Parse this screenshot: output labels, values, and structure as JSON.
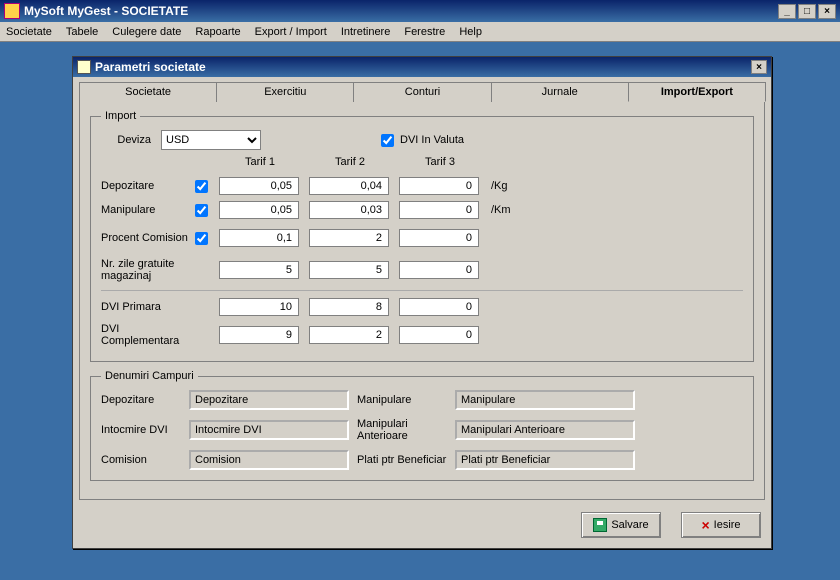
{
  "app": {
    "title": "MySoft MyGest  - SOCIETATE"
  },
  "menu": {
    "items": [
      "Societate",
      "Tabele",
      "Culegere date",
      "Rapoarte",
      "Export / Import",
      "Intretinere",
      "Ferestre",
      "Help"
    ]
  },
  "child": {
    "title": "Parametri societate"
  },
  "tabs": {
    "items": [
      "Societate",
      "Exercitiu",
      "Conturi",
      "Jurnale",
      "Import/Export"
    ],
    "active": 4
  },
  "import": {
    "legend": "Import",
    "deviza_label": "Deviza",
    "deviza_value": "USD",
    "dvi_in_valuta_label": "DVI In Valuta",
    "dvi_in_valuta_checked": true,
    "headers": {
      "t1": "Tarif 1",
      "t2": "Tarif 2",
      "t3": "Tarif 3"
    },
    "rows": {
      "depozitare": {
        "label": "Depozitare",
        "chk": true,
        "t1": "0,05",
        "t2": "0,04",
        "t3": "0",
        "unit": "/Kg"
      },
      "manipulare": {
        "label": "Manipulare",
        "chk": true,
        "t1": "0,05",
        "t2": "0,03",
        "t3": "0",
        "unit": "/Km"
      },
      "procent": {
        "label": "Procent Comision",
        "chk": true,
        "t1": "0,1",
        "t2": "2",
        "t3": "0",
        "unit": ""
      },
      "magazinaj": {
        "label": "Nr. zile gratuite magazinaj",
        "t1": "5",
        "t2": "5",
        "t3": "0",
        "unit": ""
      },
      "dvi_primara": {
        "label": "DVI Primara",
        "t1": "10",
        "t2": "8",
        "t3": "0",
        "unit": ""
      },
      "dvi_comp": {
        "label": "DVI Complementara",
        "t1": "9",
        "t2": "2",
        "t3": "0",
        "unit": ""
      }
    }
  },
  "denumiri": {
    "legend": "Denumiri Campuri",
    "depozitare_label": "Depozitare",
    "depozitare_value": "Depozitare",
    "manipulare_label": "Manipulare",
    "manipulare_value": "Manipulare",
    "intocmire_label": "Intocmire DVI",
    "intocmire_value": "Intocmire DVI",
    "manip_ant_label": "Manipulari Anterioare",
    "manip_ant_value": "Manipulari Anterioare",
    "comision_label": "Comision",
    "comision_value": "Comision",
    "plati_label": "Plati ptr Beneficiar",
    "plati_value": "Plati ptr Beneficiar"
  },
  "buttons": {
    "save": "Salvare",
    "exit": "Iesire"
  }
}
